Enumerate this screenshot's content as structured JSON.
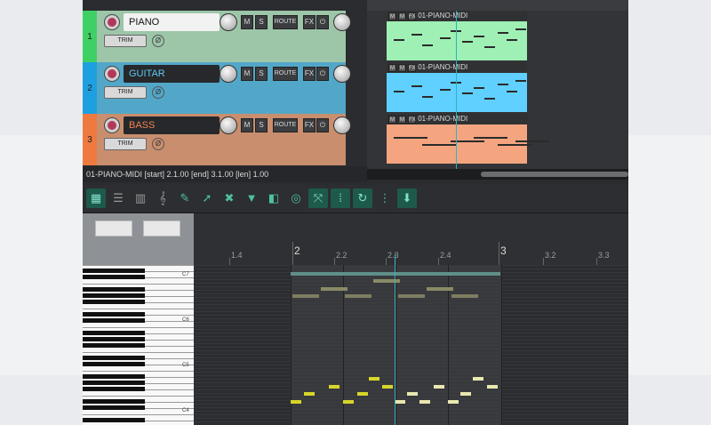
{
  "tracks": [
    {
      "num": "1",
      "name": "PIANO",
      "name_color": "#111111",
      "name_bg": "#f2f2f2",
      "color": "#9dc6a9",
      "stripe": "#3fd065"
    },
    {
      "num": "2",
      "name": "GUITAR",
      "name_color": "#5fc8f0",
      "name_bg": "#26282b",
      "color": "#52a7c8",
      "stripe": "#1ea0e0"
    },
    {
      "num": "3",
      "name": "BASS",
      "name_color": "#f08050",
      "name_bg": "#26282b",
      "color": "#c98e6e",
      "stripe": "#ef7a40"
    }
  ],
  "track_buttons": {
    "mute": "M",
    "solo": "S",
    "route": "ROUTE",
    "fx": "FX",
    "power": "⏻",
    "trim": "TRIM",
    "env": "Ø"
  },
  "items": [
    {
      "title": "01-PIANO-MIDI",
      "color": "#9ff0b4"
    },
    {
      "title": "01-PIANO-MIDI",
      "color": "#5fd0ff"
    },
    {
      "title": "01-PIANO-MIDI",
      "color": "#f4a580"
    }
  ],
  "item_header_buttons": [
    "M",
    "M",
    "FX"
  ],
  "info_bar": "01-PIANO-MIDI [start] 2.1.00 [end] 3.1.00 [len] 1.00",
  "toolbar_icons": [
    "grid-view-icon",
    "list-view-icon",
    "keys-view-icon",
    "treble-clef-icon",
    "insert-note-icon",
    "select-note-icon",
    "erase-note-icon",
    "filter-icon",
    "contrast-icon",
    "quantize-icon",
    "snap-icon",
    "grid-icon",
    "loop-icon",
    "footsteps-icon",
    "save-icon"
  ],
  "ruler": {
    "labels": [
      {
        "t": "1.4",
        "big": false
      },
      {
        "t": "2",
        "big": true
      },
      {
        "t": "2.2",
        "big": false
      },
      {
        "t": "2.3",
        "big": false
      },
      {
        "t": "2.4",
        "big": false
      },
      {
        "t": "3",
        "big": true
      },
      {
        "t": "3.2",
        "big": false
      },
      {
        "t": "3.3",
        "big": false
      }
    ]
  },
  "key_labels": [
    "C7",
    "C6",
    "C5",
    "C4"
  ]
}
